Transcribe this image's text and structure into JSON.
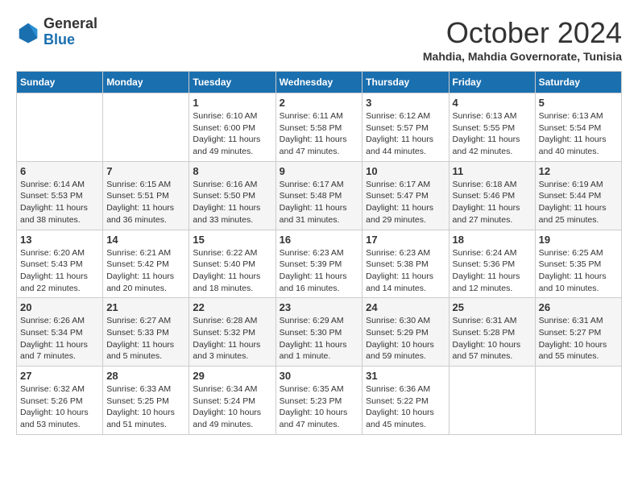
{
  "logo": {
    "general": "General",
    "blue": "Blue"
  },
  "header": {
    "month": "October 2024",
    "subtitle": "Mahdia, Mahdia Governorate, Tunisia"
  },
  "weekdays": [
    "Sunday",
    "Monday",
    "Tuesday",
    "Wednesday",
    "Thursday",
    "Friday",
    "Saturday"
  ],
  "weeks": [
    [
      {
        "day": "",
        "info": ""
      },
      {
        "day": "",
        "info": ""
      },
      {
        "day": "1",
        "info": "Sunrise: 6:10 AM\nSunset: 6:00 PM\nDaylight: 11 hours and 49 minutes."
      },
      {
        "day": "2",
        "info": "Sunrise: 6:11 AM\nSunset: 5:58 PM\nDaylight: 11 hours and 47 minutes."
      },
      {
        "day": "3",
        "info": "Sunrise: 6:12 AM\nSunset: 5:57 PM\nDaylight: 11 hours and 44 minutes."
      },
      {
        "day": "4",
        "info": "Sunrise: 6:13 AM\nSunset: 5:55 PM\nDaylight: 11 hours and 42 minutes."
      },
      {
        "day": "5",
        "info": "Sunrise: 6:13 AM\nSunset: 5:54 PM\nDaylight: 11 hours and 40 minutes."
      }
    ],
    [
      {
        "day": "6",
        "info": "Sunrise: 6:14 AM\nSunset: 5:53 PM\nDaylight: 11 hours and 38 minutes."
      },
      {
        "day": "7",
        "info": "Sunrise: 6:15 AM\nSunset: 5:51 PM\nDaylight: 11 hours and 36 minutes."
      },
      {
        "day": "8",
        "info": "Sunrise: 6:16 AM\nSunset: 5:50 PM\nDaylight: 11 hours and 33 minutes."
      },
      {
        "day": "9",
        "info": "Sunrise: 6:17 AM\nSunset: 5:48 PM\nDaylight: 11 hours and 31 minutes."
      },
      {
        "day": "10",
        "info": "Sunrise: 6:17 AM\nSunset: 5:47 PM\nDaylight: 11 hours and 29 minutes."
      },
      {
        "day": "11",
        "info": "Sunrise: 6:18 AM\nSunset: 5:46 PM\nDaylight: 11 hours and 27 minutes."
      },
      {
        "day": "12",
        "info": "Sunrise: 6:19 AM\nSunset: 5:44 PM\nDaylight: 11 hours and 25 minutes."
      }
    ],
    [
      {
        "day": "13",
        "info": "Sunrise: 6:20 AM\nSunset: 5:43 PM\nDaylight: 11 hours and 22 minutes."
      },
      {
        "day": "14",
        "info": "Sunrise: 6:21 AM\nSunset: 5:42 PM\nDaylight: 11 hours and 20 minutes."
      },
      {
        "day": "15",
        "info": "Sunrise: 6:22 AM\nSunset: 5:40 PM\nDaylight: 11 hours and 18 minutes."
      },
      {
        "day": "16",
        "info": "Sunrise: 6:23 AM\nSunset: 5:39 PM\nDaylight: 11 hours and 16 minutes."
      },
      {
        "day": "17",
        "info": "Sunrise: 6:23 AM\nSunset: 5:38 PM\nDaylight: 11 hours and 14 minutes."
      },
      {
        "day": "18",
        "info": "Sunrise: 6:24 AM\nSunset: 5:36 PM\nDaylight: 11 hours and 12 minutes."
      },
      {
        "day": "19",
        "info": "Sunrise: 6:25 AM\nSunset: 5:35 PM\nDaylight: 11 hours and 10 minutes."
      }
    ],
    [
      {
        "day": "20",
        "info": "Sunrise: 6:26 AM\nSunset: 5:34 PM\nDaylight: 11 hours and 7 minutes."
      },
      {
        "day": "21",
        "info": "Sunrise: 6:27 AM\nSunset: 5:33 PM\nDaylight: 11 hours and 5 minutes."
      },
      {
        "day": "22",
        "info": "Sunrise: 6:28 AM\nSunset: 5:32 PM\nDaylight: 11 hours and 3 minutes."
      },
      {
        "day": "23",
        "info": "Sunrise: 6:29 AM\nSunset: 5:30 PM\nDaylight: 11 hours and 1 minute."
      },
      {
        "day": "24",
        "info": "Sunrise: 6:30 AM\nSunset: 5:29 PM\nDaylight: 10 hours and 59 minutes."
      },
      {
        "day": "25",
        "info": "Sunrise: 6:31 AM\nSunset: 5:28 PM\nDaylight: 10 hours and 57 minutes."
      },
      {
        "day": "26",
        "info": "Sunrise: 6:31 AM\nSunset: 5:27 PM\nDaylight: 10 hours and 55 minutes."
      }
    ],
    [
      {
        "day": "27",
        "info": "Sunrise: 6:32 AM\nSunset: 5:26 PM\nDaylight: 10 hours and 53 minutes."
      },
      {
        "day": "28",
        "info": "Sunrise: 6:33 AM\nSunset: 5:25 PM\nDaylight: 10 hours and 51 minutes."
      },
      {
        "day": "29",
        "info": "Sunrise: 6:34 AM\nSunset: 5:24 PM\nDaylight: 10 hours and 49 minutes."
      },
      {
        "day": "30",
        "info": "Sunrise: 6:35 AM\nSunset: 5:23 PM\nDaylight: 10 hours and 47 minutes."
      },
      {
        "day": "31",
        "info": "Sunrise: 6:36 AM\nSunset: 5:22 PM\nDaylight: 10 hours and 45 minutes."
      },
      {
        "day": "",
        "info": ""
      },
      {
        "day": "",
        "info": ""
      }
    ]
  ]
}
